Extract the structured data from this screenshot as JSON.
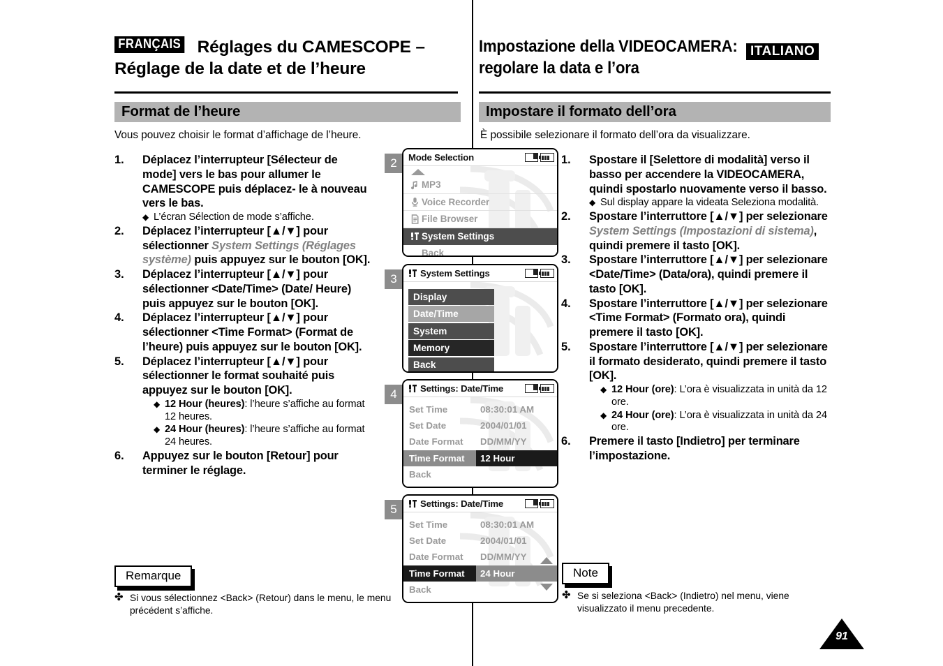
{
  "header": {
    "lang_fr": "FRANÇAIS",
    "lang_it": "ITALIANO",
    "title_fr_line1": "Réglages du CAMESCOPE –",
    "title_fr_line2": "Réglage de la date et de l’heure",
    "title_it_line1": "Impostazione della VIDEOCAMERA:",
    "title_it_line2": "regolare la data e l’ora"
  },
  "section": {
    "fr_heading": "Format de l’heure",
    "it_heading": "Impostare il formato dell’ora",
    "fr_intro": "Vous pouvez choisir le format d’affichage de l’heure.",
    "it_intro": "È possibile selezionare il formato dell’ora da visualizzare."
  },
  "steps_fr": [
    {
      "num": "1.",
      "text_pre": "Déplacez l’interrupteur [Sélecteur de mode] vers le bas pour allumer le CAMESCOPE puis déplacez- le à nouveau vers le bas.",
      "subs": [
        {
          "diamond": "◆",
          "text": "L’écran Sélection de mode s’affiche."
        }
      ]
    },
    {
      "num": "2.",
      "text_pre": "Déplacez l’interrupteur [▲/▼] pour sélectionner ",
      "gray": "System Settings (Réglages  système)",
      "text_post": " puis appuyez sur le bouton [OK].",
      "subs": []
    },
    {
      "num": "3.",
      "text_pre": "Déplacez l’interrupteur [▲/▼] pour sélectionner <Date/Time> (Date/ Heure) puis appuyez sur le bouton [OK].",
      "subs": []
    },
    {
      "num": "4.",
      "text_pre": "Déplacez l’interrupteur [▲/▼] pour sélectionner <Time Format> (Format de l’heure) puis appuyez sur le bouton [OK].",
      "subs": []
    },
    {
      "num": "5.",
      "text_pre": "Déplacez l’interrupteur [▲/▼] pour sélectionner le format souhaité puis appuyez sur le bouton [OK].",
      "subs": [
        {
          "diamond": "◆",
          "bold": "12 Hour (heures)",
          "text": ": l’heure s’affiche au format 12 heures."
        },
        {
          "diamond": "◆",
          "bold": "24 Hour (heures)",
          "text": ": l’heure s’affiche au format 24 heures."
        }
      ]
    },
    {
      "num": "6.",
      "text_pre": "Appuyez sur le bouton [Retour] pour terminer le réglage.",
      "subs": []
    }
  ],
  "steps_it": [
    {
      "num": "1.",
      "text_pre": "Spostare il [Selettore di modalità] verso il basso per accendere la VIDEOCAMERA, quindi spostarlo nuovamente verso il basso.",
      "subs": [
        {
          "diamond": "◆",
          "text": "Sul display appare la videata Seleziona modalità."
        }
      ]
    },
    {
      "num": "2.",
      "text_pre": "Spostare l’interruttore [▲/▼] per selezionare ",
      "gray": "System Settings (Impostazioni di sistema)",
      "text_post": ", quindi premere il tasto [OK].",
      "subs": []
    },
    {
      "num": "3.",
      "text_pre": "Spostare l’interruttore [▲/▼] per selezionare <Date/Time> (Data/ora), quindi premere il tasto [OK].",
      "subs": []
    },
    {
      "num": "4.",
      "text_pre": "Spostare l’interruttore [▲/▼] per selezionare <Time Format> (Formato ora), quindi premere il tasto [OK].",
      "subs": []
    },
    {
      "num": "5.",
      "text_pre": "Spostare l’interruttore [▲/▼] per selezionare il formato desiderato, quindi premere il tasto [OK].",
      "subs": [
        {
          "diamond": "◆",
          "bold": "12 Hour (ore)",
          "text": ": L’ora è visualizzata in unità da 12 ore."
        },
        {
          "diamond": "◆",
          "bold": "24 Hour (ore)",
          "text": ": L’ora è visualizzata in unità da 24 ore."
        }
      ]
    },
    {
      "num": "6.",
      "text_pre": "Premere il tasto [Indietro] per terminare l’impostazione.",
      "subs": []
    }
  ],
  "notes": {
    "fr_label": "Remarque",
    "it_label": "Note",
    "fr_symbol": "✤",
    "it_symbol": "✤",
    "fr_text": "Si vous sélectionnez <Back> (Retour) dans le menu, le menu précédent s’affiche.",
    "it_text": "Se si seleziona <Back> (Indietro) nel menu, viene visualizzato il menu precedente."
  },
  "screens": [
    {
      "badge": "2",
      "title": "Mode Selection",
      "kind": "mode",
      "rows": [
        {
          "icon": "music-note-icon",
          "glyph": "♪",
          "label": "MP3",
          "selected": false
        },
        {
          "icon": "microphone-icon",
          "glyph": "⬤",
          "label": "Voice Recorder",
          "selected": false
        },
        {
          "icon": "document-icon",
          "glyph": "▤",
          "label": "File Browser",
          "selected": false
        },
        {
          "icon": "tools-icon",
          "glyph": "⚒",
          "label": "System Settings",
          "selected": true
        },
        {
          "icon": "",
          "glyph": "",
          "label": "Back",
          "selected": false
        }
      ]
    },
    {
      "badge": "3",
      "title": "System Settings",
      "kind": "buttons",
      "title_icon": "tools-icon",
      "rows": [
        {
          "label": "Display",
          "shade": "d"
        },
        {
          "label": "Date/Time",
          "shade": "l"
        },
        {
          "label": "System",
          "shade": "d"
        },
        {
          "label": "Memory",
          "shade": "k"
        },
        {
          "label": "Back",
          "shade": "d"
        }
      ]
    },
    {
      "badge": "4",
      "title": "Settings: Date/Time",
      "kind": "datetime",
      "title_icon": "tools-icon",
      "highlight": "hl",
      "scrollbars": false,
      "rows": [
        {
          "label": "Set Time",
          "value": "08:30:01 AM",
          "selected": false
        },
        {
          "label": "Set Date",
          "value": "2004/01/01",
          "selected": false
        },
        {
          "label": "Date Format",
          "value": "DD/MM/YY",
          "selected": false
        },
        {
          "label": "Time Format",
          "value": "12 Hour",
          "selected": true
        },
        {
          "label": "Back",
          "value": "",
          "selected": false
        }
      ]
    },
    {
      "badge": "5",
      "title": "Settings: Date/Time",
      "kind": "datetime",
      "title_icon": "tools-icon",
      "highlight": "hl2",
      "scrollbars": true,
      "rows": [
        {
          "label": "Set Time",
          "value": "08:30:01 AM",
          "selected": false
        },
        {
          "label": "Set Date",
          "value": "2004/01/01",
          "selected": false
        },
        {
          "label": "Date Format",
          "value": "DD/MM/YY",
          "selected": false
        },
        {
          "label": "Time Format",
          "value": "24 Hour",
          "selected": true
        },
        {
          "label": "Back",
          "value": "",
          "selected": false
        }
      ]
    }
  ],
  "page_number": "91"
}
